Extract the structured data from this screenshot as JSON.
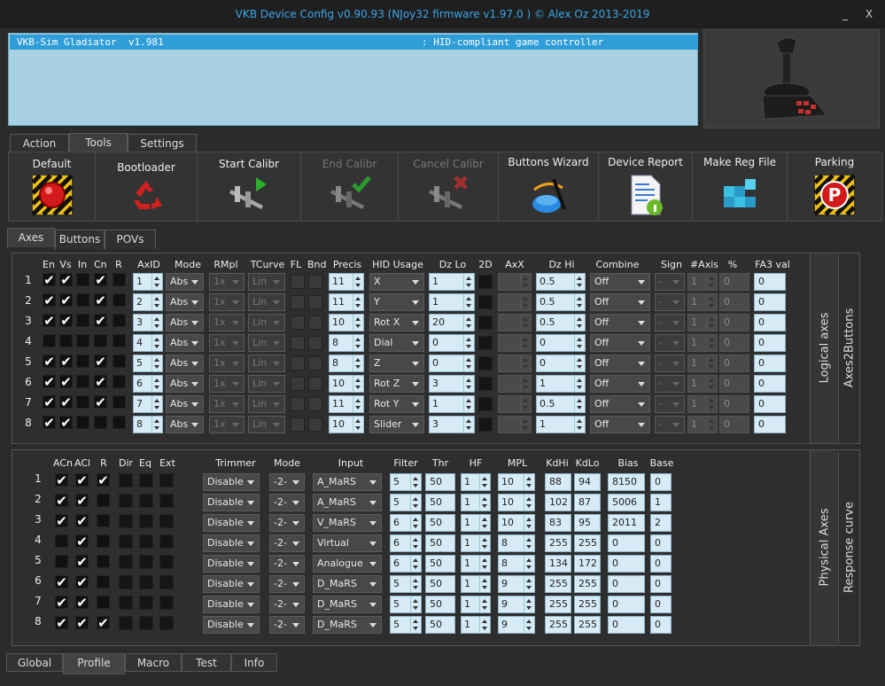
{
  "window": {
    "title": "VKB Device Config v0.90.93 (NJoy32 firmware v1.97.0  ) © Alex Oz 2013-2019",
    "minimize": "_",
    "close": "X"
  },
  "device_list": [
    {
      "name": "VKB-Sim Gladiator  v1.981",
      "type": ": HID-compliant game controller"
    }
  ],
  "main_tabs": [
    {
      "label": "Action"
    },
    {
      "label": "Tools"
    },
    {
      "label": "Settings"
    }
  ],
  "tools": [
    {
      "label": "Default",
      "icon": "red-button-icon",
      "enabled": true
    },
    {
      "label": "Bootloader",
      "icon": "recycle-icon",
      "enabled": true
    },
    {
      "label": "Start Calibr",
      "icon": "caliper-play-icon",
      "enabled": true
    },
    {
      "label": "End Calibr",
      "icon": "caliper-check-icon",
      "enabled": false
    },
    {
      "label": "Cancel Calibr",
      "icon": "caliper-cancel-icon",
      "enabled": false
    },
    {
      "label": "Buttons Wizard",
      "icon": "wizard-icon",
      "enabled": true
    },
    {
      "label": "Device Report",
      "icon": "report-icon",
      "enabled": true
    },
    {
      "label": "Make Reg File",
      "icon": "registry-icon",
      "enabled": true
    },
    {
      "label": "Parking",
      "icon": "parking-icon",
      "enabled": true
    }
  ],
  "sub_tabs": [
    {
      "label": "Axes"
    },
    {
      "label": "Buttons"
    },
    {
      "label": "POVs"
    }
  ],
  "logical": {
    "side_label_1": "Logical axes",
    "side_label_2": "Axes2Buttons",
    "headers": [
      "En",
      "Vs",
      "In",
      "Cn",
      "R",
      "AxID",
      "Mode",
      "RMpl",
      "TCurve",
      "FL",
      "Bnd",
      "Precis",
      "HID Usage",
      "Dz Lo",
      "2D",
      "AxX",
      "Dz Hi",
      "Combine",
      "Sign",
      "#Axis",
      "%",
      "FA3 val"
    ],
    "rows": [
      {
        "n": "1",
        "en": true,
        "vs": true,
        "in": false,
        "cn": true,
        "r": false,
        "axid": "1",
        "mode": "Abs",
        "rmpl": "1x",
        "tcurve": "Lin",
        "precis": "11",
        "hid": "X",
        "dzlo": "1",
        "dzhi": "0.5",
        "combine": "Off",
        "sign": "-",
        "axis": "1",
        "pct": "0",
        "fa3": "0"
      },
      {
        "n": "2",
        "en": true,
        "vs": true,
        "in": false,
        "cn": true,
        "r": false,
        "axid": "2",
        "mode": "Abs",
        "rmpl": "1x",
        "tcurve": "Lin",
        "precis": "11",
        "hid": "Y",
        "dzlo": "1",
        "dzhi": "0.5",
        "combine": "Off",
        "sign": "-",
        "axis": "1",
        "pct": "0",
        "fa3": "0"
      },
      {
        "n": "3",
        "en": true,
        "vs": true,
        "in": false,
        "cn": true,
        "r": false,
        "axid": "3",
        "mode": "Abs",
        "rmpl": "1x",
        "tcurve": "Lin",
        "precis": "10",
        "hid": "Rot X",
        "dzlo": "20",
        "dzhi": "0.5",
        "combine": "Off",
        "sign": "-",
        "axis": "1",
        "pct": "0",
        "fa3": "0"
      },
      {
        "n": "4",
        "en": false,
        "vs": false,
        "in": false,
        "cn": false,
        "r": false,
        "axid": "4",
        "mode": "Abs",
        "rmpl": "1x",
        "tcurve": "Lin",
        "precis": "8",
        "hid": "Dial",
        "dzlo": "0",
        "dzhi": "0",
        "combine": "Off",
        "sign": "-",
        "axis": "1",
        "pct": "0",
        "fa3": "0"
      },
      {
        "n": "5",
        "en": true,
        "vs": true,
        "in": false,
        "cn": true,
        "r": false,
        "axid": "5",
        "mode": "Abs",
        "rmpl": "1x",
        "tcurve": "Lin",
        "precis": "8",
        "hid": "Z",
        "dzlo": "0",
        "dzhi": "0",
        "combine": "Off",
        "sign": "-",
        "axis": "1",
        "pct": "0",
        "fa3": "0"
      },
      {
        "n": "6",
        "en": true,
        "vs": true,
        "in": false,
        "cn": true,
        "r": false,
        "axid": "6",
        "mode": "Abs",
        "rmpl": "1x",
        "tcurve": "Lin",
        "precis": "10",
        "hid": "Rot Z",
        "dzlo": "3",
        "dzhi": "1",
        "combine": "Off",
        "sign": "-",
        "axis": "1",
        "pct": "0",
        "fa3": "0"
      },
      {
        "n": "7",
        "en": true,
        "vs": true,
        "in": false,
        "cn": true,
        "r": false,
        "axid": "7",
        "mode": "Abs",
        "rmpl": "1x",
        "tcurve": "Lin",
        "precis": "11",
        "hid": "Rot Y",
        "dzlo": "1",
        "dzhi": "0.5",
        "combine": "Off",
        "sign": "-",
        "axis": "1",
        "pct": "0",
        "fa3": "0"
      },
      {
        "n": "8",
        "en": true,
        "vs": true,
        "in": false,
        "cn": false,
        "r": false,
        "axid": "8",
        "mode": "Abs",
        "rmpl": "1x",
        "tcurve": "Lin",
        "precis": "10",
        "hid": "Slider",
        "dzlo": "3",
        "dzhi": "1",
        "combine": "Off",
        "sign": "-",
        "axis": "1",
        "pct": "0",
        "fa3": "0"
      }
    ]
  },
  "physical": {
    "side_label_1": "Physical Axes",
    "side_label_2": "Response curve",
    "headers": [
      "ACn",
      "ACl",
      "R",
      "Dir",
      "Eq",
      "Ext",
      "Trimmer",
      "Mode",
      "Input",
      "Filter",
      "Thr",
      "HF",
      "MPL",
      "KdHi",
      "KdLo",
      "Bias",
      "Base"
    ],
    "rows": [
      {
        "n": "1",
        "acn": true,
        "acl": true,
        "r": true,
        "trimmer": "Disable",
        "mode": "-2-",
        "input": "A_MaRS",
        "filter": "5",
        "thr": "50",
        "hf": "1",
        "mpl": "10",
        "kdhi": "88",
        "kdlo": "94",
        "bias": "8150",
        "base": "0"
      },
      {
        "n": "2",
        "acn": true,
        "acl": true,
        "r": false,
        "trimmer": "Disable",
        "mode": "-2-",
        "input": "A_MaRS",
        "filter": "5",
        "thr": "50",
        "hf": "1",
        "mpl": "10",
        "kdhi": "102",
        "kdlo": "87",
        "bias": "5006",
        "base": "1"
      },
      {
        "n": "3",
        "acn": true,
        "acl": true,
        "r": false,
        "trimmer": "Disable",
        "mode": "-2-",
        "input": "V_MaRS",
        "filter": "6",
        "thr": "50",
        "hf": "1",
        "mpl": "10",
        "kdhi": "83",
        "kdlo": "95",
        "bias": "2011",
        "base": "2"
      },
      {
        "n": "4",
        "acn": false,
        "acl": true,
        "r": false,
        "trimmer": "Disable",
        "mode": "-2-",
        "input": "Virtual",
        "filter": "6",
        "thr": "50",
        "hf": "1",
        "mpl": "8",
        "kdhi": "255",
        "kdlo": "255",
        "bias": "0",
        "base": "0"
      },
      {
        "n": "5",
        "acn": false,
        "acl": true,
        "r": false,
        "trimmer": "Disable",
        "mode": "-2-",
        "input": "Analogue",
        "filter": "6",
        "thr": "50",
        "hf": "1",
        "mpl": "8",
        "kdhi": "134",
        "kdlo": "172",
        "bias": "0",
        "base": "0"
      },
      {
        "n": "6",
        "acn": true,
        "acl": true,
        "r": false,
        "trimmer": "Disable",
        "mode": "-2-",
        "input": "D_MaRS",
        "filter": "5",
        "thr": "50",
        "hf": "1",
        "mpl": "9",
        "kdhi": "255",
        "kdlo": "255",
        "bias": "0",
        "base": "0"
      },
      {
        "n": "7",
        "acn": true,
        "acl": true,
        "r": false,
        "trimmer": "Disable",
        "mode": "-2-",
        "input": "D_MaRS",
        "filter": "5",
        "thr": "50",
        "hf": "1",
        "mpl": "9",
        "kdhi": "255",
        "kdlo": "255",
        "bias": "0",
        "base": "0"
      },
      {
        "n": "8",
        "acn": true,
        "acl": true,
        "r": true,
        "trimmer": "Disable",
        "mode": "-2-",
        "input": "D_MaRS",
        "filter": "5",
        "thr": "50",
        "hf": "1",
        "mpl": "9",
        "kdhi": "255",
        "kdlo": "255",
        "bias": "0",
        "base": "0"
      }
    ]
  },
  "bottom_tabs": [
    {
      "label": "Global"
    },
    {
      "label": "Profile"
    },
    {
      "label": "Macro"
    },
    {
      "label": "Test"
    },
    {
      "label": "Info"
    }
  ],
  "colors": {
    "accent": "#3aa6ea",
    "selection": "#2f9ed8",
    "field": "#d6ebf6"
  }
}
